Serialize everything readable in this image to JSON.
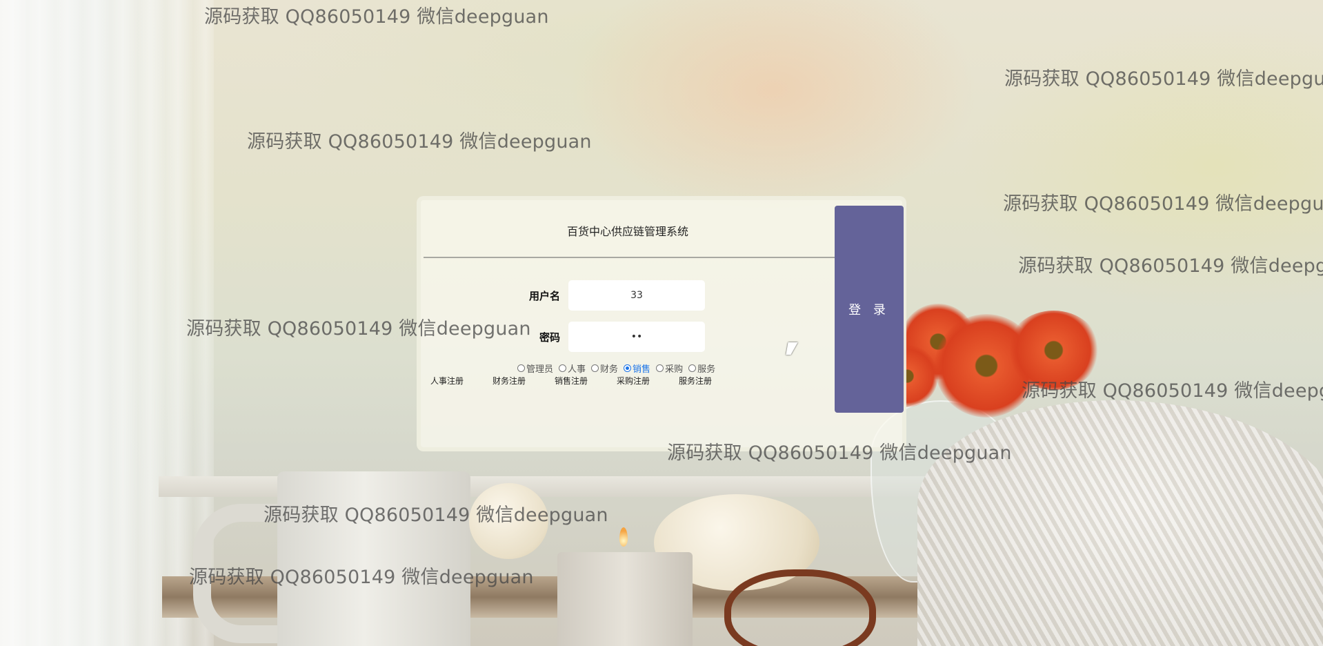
{
  "app": {
    "title": "百货中心供应链管理系统"
  },
  "login": {
    "username_label": "用户名",
    "username_value": "33",
    "password_label": "密码",
    "password_value": "••",
    "login_button": "登 录",
    "roles": [
      {
        "label": "管理员",
        "selected": false
      },
      {
        "label": "人事",
        "selected": false
      },
      {
        "label": "财务",
        "selected": false
      },
      {
        "label": "销售",
        "selected": true
      },
      {
        "label": "采购",
        "selected": false
      },
      {
        "label": "服务",
        "selected": false
      }
    ],
    "register_links": [
      "人事注册",
      "财务注册",
      "销售注册",
      "采购注册",
      "服务注册"
    ]
  },
  "watermark": {
    "text": "源码获取 QQ86050149 微信deepguan"
  },
  "colors": {
    "login_button": "#646399",
    "selected_role": "#1a73e8",
    "card_background": "#faf9ee"
  }
}
